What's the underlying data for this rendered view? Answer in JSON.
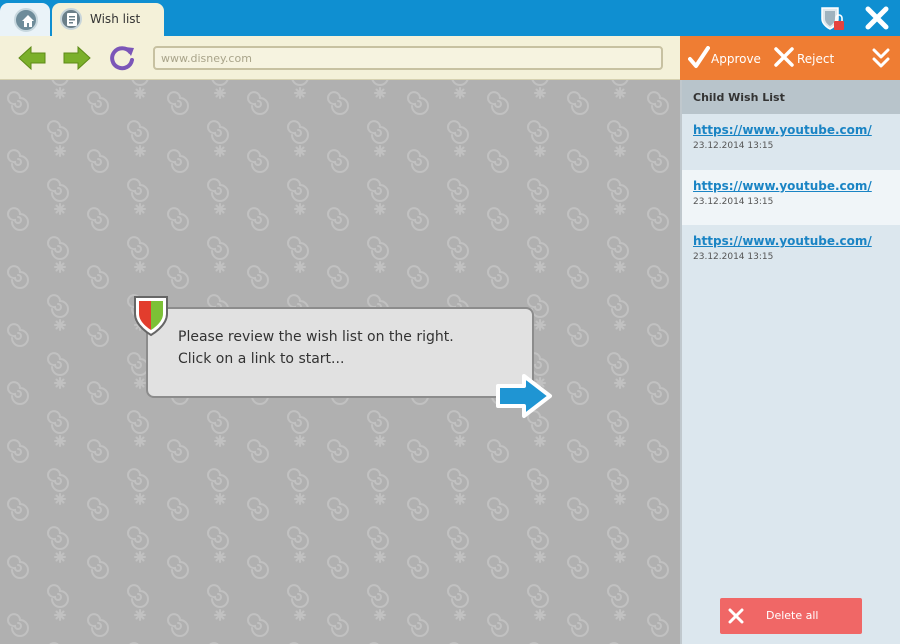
{
  "tabs": {
    "home_icon": "home-icon",
    "wish_tab_label": "Wish list"
  },
  "toolbar": {
    "url": "www.disney.com"
  },
  "dialog": {
    "line1": "Please review the wish list on the right.",
    "line2": "Click on a link to start..."
  },
  "panel": {
    "approve_label": "Approve",
    "reject_label": "Reject",
    "title": "Child Wish List",
    "items": [
      {
        "url": "https://www.youtube.com/",
        "date": "23.12.2014 13:15"
      },
      {
        "url": "https://www.youtube.com/",
        "date": "23.12.2014 13:15"
      },
      {
        "url": "https://www.youtube.com/",
        "date": "23.12.2014 13:15"
      }
    ],
    "delete_all_label": "Delete all"
  },
  "colors": {
    "titlebar": "#0f8fd1",
    "accent_orange": "#ef7d33",
    "link": "#1a84c4",
    "delete": "#f06766",
    "nav_green": "#7bb02a",
    "reload_purple": "#7b56b8"
  }
}
